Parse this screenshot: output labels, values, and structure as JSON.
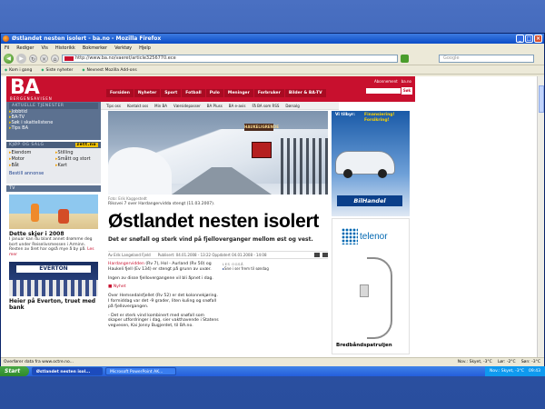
{
  "browser": {
    "title": "Østlandet nesten isolert - ba.no - Mozilla Firefox",
    "menu": [
      "Fil",
      "Rediger",
      "Vis",
      "Historikk",
      "Bokmerker",
      "Verktøy",
      "Hjelp"
    ],
    "url": "http://www.ba.no/vaeret/article3256770.ece",
    "search_placeholder": "Google",
    "bookmarks": [
      "Kom i gang",
      "Siste nyheter",
      "Nevnest Mozilla Add-ons"
    ],
    "status_left": "Overfører data fra www.octre.no...",
    "status_right": [
      "Nov.: Skyet, -3°C",
      "Lør: -2°C",
      "Søn: -3°C"
    ]
  },
  "ba": {
    "logo": "BA",
    "tagline": "BERGENSAVISEN",
    "top_links": [
      "Abonnement",
      "ba.no"
    ],
    "search_button": "Søk",
    "tabs": [
      "Forsiden",
      "Nyheter",
      "Sport",
      "Fotball",
      "Pulo",
      "Meninger",
      "Forbruker",
      "Bilder & BA-TV"
    ],
    "subnav": [
      "Tips oss",
      "Kontakt oss",
      "Min BA",
      "Værsidepasser",
      "BA Pluss",
      "BA e-avis",
      "Få BA som RSS",
      "Dørsalg"
    ]
  },
  "leftcol": {
    "services_header": "AKTUELLE TJENESTER",
    "services": [
      "Jobbtid",
      "BA-TV",
      "Søk i skattelistene",
      "Tips BA"
    ],
    "buysell_header": "KJØP OG SALG",
    "buysell_badge": "zett.no",
    "buysell_items": [
      "Eiendom",
      "Stilling",
      "Motor",
      "Smått og stort",
      "Båt",
      "Kart"
    ],
    "buysell_more": "Bestill annonse",
    "tv_header": "TV",
    "tv_h1": "Dette skjer i 2008",
    "tv_p1": "I januar kan du blant annet drømme deg bort under Reiselivsmessen i Arminn. Resten av året har også mye å by på.",
    "tv_p1_more": "Les mer",
    "tv_banner": "EVERTON",
    "tv_h2": "Heier på Everton, truet med bank"
  },
  "article": {
    "photo_credit": "Foto: Erik Kaggestedt",
    "photo_sign": "HAUKELIGRENDE",
    "caption": "Riksvei 7 over Hardangervidda stengt (11.03.2007).",
    "headline": "Østlandet nesten isolert",
    "lead": "Det er snøfall og sterk vind på fjelloverganger mellom øst og vest.",
    "author": "Av Erik Langeland Fjeld",
    "timestamp": "Publisert: 04.01.2008 - 13:22 Oppdatert 04.01.2008 - 14:08",
    "body1_prefix": "Hardangervidden",
    "body1": " (Rv 7), Hol - Aurland (Rv 50) og Haukeli fjell (Ev 134) er stengt på grunn av uvær.",
    "body2": "Ingen av disse fjellovergangene vil bli åpnet i dag.",
    "body3": "Nyhet",
    "body4": "Over Hemsedalsfjellet (Rv 52) er det kolonnekjøring. I formiddag var det -9 grader, liten kuling og snøfall på fjellovergangen.",
    "body5": "- Det er sterk vind kombinert med snøfall som skaper utfordringer i dag, sier vakthavende i Statens vegvesen, Kai Jonny Bugjerdet, til BA.no.",
    "related_header": "LES OGSÅ",
    "related": [
      "Sne i ser frem til søndag"
    ]
  },
  "ads": {
    "ad1_t1": "Vi tilbyr:",
    "ad1_t2": "Finansiering! Forsikring!",
    "ad1_brand": "BilHandel",
    "ad2_brand": "telenor",
    "ad2_caption": "Bredbåndspatruljen"
  },
  "taskbar": {
    "start": "Start",
    "tasks": [
      "Østlandet nesten isol...",
      "Microsoft PowerPoint AK..."
    ],
    "tray_weather": "Nov.: Skyet, -3°C",
    "clock": "09:43"
  }
}
